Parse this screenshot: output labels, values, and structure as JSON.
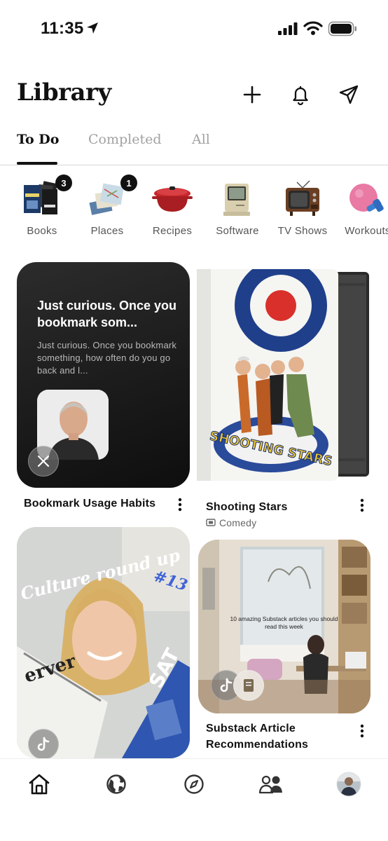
{
  "status_bar": {
    "time": "11:35"
  },
  "header": {
    "title": "Library"
  },
  "tabs": [
    {
      "label": "To Do",
      "active": true
    },
    {
      "label": "Completed",
      "active": false
    },
    {
      "label": "All",
      "active": false
    }
  ],
  "categories": [
    {
      "label": "Books",
      "badge": "3",
      "icon": "books-image"
    },
    {
      "label": "Places",
      "badge": "1",
      "icon": "maps-image"
    },
    {
      "label": "Recipes",
      "icon": "dutch-oven-image"
    },
    {
      "label": "Software",
      "icon": "computer-image"
    },
    {
      "label": "TV Shows",
      "icon": "television-image"
    },
    {
      "label": "Workouts",
      "icon": "kettlebell-image"
    }
  ],
  "cards": {
    "bookmark": {
      "headline": "Just curious. Once you bookmark som...",
      "body": "Just curious. Once you bookmark something, how often do you go back and l...",
      "title": "Bookmark Usage Habits",
      "source_icon": "x-icon"
    },
    "shooting_stars": {
      "title": "Shooting Stars",
      "subtitle": "Comedy",
      "poster_text": "SHOOTING STARS"
    },
    "culture": {
      "overlay_line1": "Culture round up",
      "overlay_number": "#13",
      "source_icon": "tiktok-icon"
    },
    "substack": {
      "overlay_caption": "10 amazing Substack articles you should read this week",
      "title_line1": "Substack Article",
      "title_line2": "Recommendations",
      "source_icon": "tiktok-icon"
    }
  },
  "colors": {
    "text": "#111111",
    "muted": "#a2a2a2",
    "badge": "#111111",
    "card_dark": "#1c1c1c"
  }
}
